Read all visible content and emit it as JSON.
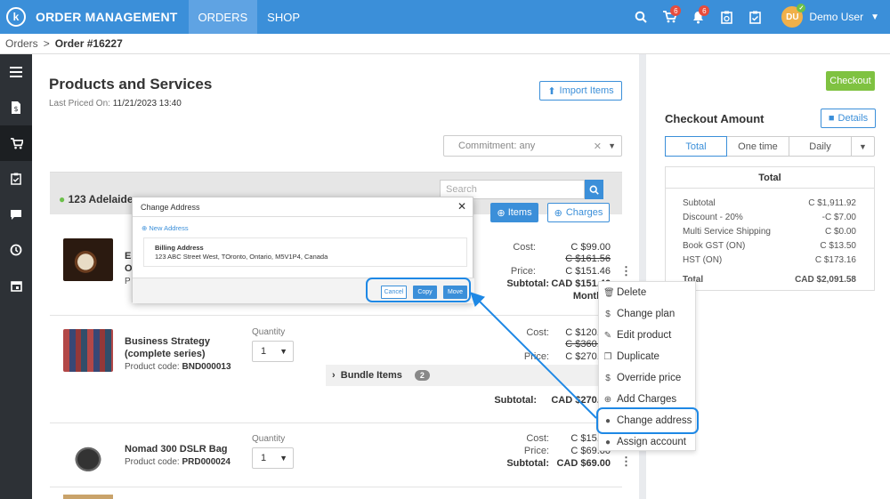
{
  "header": {
    "logo": "k",
    "app_title": "ORDER MANAGEMENT",
    "nav": [
      "ORDERS",
      "SHOP"
    ],
    "cart_badge": "6",
    "bell_badge": "6",
    "avatar_initials": "DU",
    "user_name": "Demo User"
  },
  "breadcrumb": {
    "parent": "Orders",
    "sep": ">",
    "current": "Order #16227"
  },
  "page": {
    "title": "Products and Services",
    "last_priced_label": "Last Priced On:",
    "last_priced_value": "11/21/2023 13:40",
    "import_label": "Import Items",
    "commitment_placeholder": "Commitment: any",
    "address": "123 Adelaide",
    "search_placeholder": "Search",
    "items_label": "Items",
    "charges_label": "Charges"
  },
  "products": [
    {
      "name_part": "Es",
      "name_part2": "O",
      "code_part": "P",
      "cost_label": "Cost:",
      "cost": "C $99.00",
      "list_price": "C $161.56",
      "price_label": "Price:",
      "price": "C $151.46",
      "subtotal_label": "Subtotal:",
      "subtotal": "CAD $151.46",
      "period": "Monthly"
    },
    {
      "name": "Business Strategy (complete series)",
      "code_label": "Product code:",
      "code": "BND000013",
      "qty_label": "Quantity",
      "qty": "1",
      "cost_label": "Cost:",
      "cost": "C $120.00",
      "list_price": "C $360.00",
      "price_label": "Price:",
      "price": "C $270.00",
      "bundle_label": "Bundle Items",
      "bundle_count": "2",
      "subtotal_label": "Subtotal:",
      "subtotal": "CAD $270.00"
    },
    {
      "name": "Nomad 300 DSLR Bag",
      "code_label": "Product code:",
      "code": "PRD000024",
      "qty_label": "Quantity",
      "qty": "1",
      "cost_label": "Cost:",
      "cost": "C $15.00",
      "price_label": "Price:",
      "price": "C $69.00",
      "subtotal_label": "Subtotal:",
      "subtotal": "CAD $69.00"
    }
  ],
  "context_menu": [
    "Delete",
    "Change plan",
    "Edit product",
    "Duplicate",
    "Override price",
    "Add Charges",
    "Change address",
    "Assign account"
  ],
  "dialog": {
    "title": "Change Address",
    "new_address": "New Address",
    "billing_title": "Billing Address",
    "billing_address": "123 ABC Street West, TOronto, Ontario, M5V1P4, Canada",
    "cancel": "Cancel",
    "copy": "Copy",
    "move": "Move"
  },
  "checkout": {
    "button": "Checkout",
    "title": "Checkout Amount",
    "details": "Details",
    "tabs": [
      "Total",
      "One time",
      "Daily"
    ],
    "box_title": "Total",
    "lines": [
      {
        "label": "Subtotal",
        "value": "C $1,911.92"
      },
      {
        "label": "Discount - 20%",
        "value": "-C $7.00"
      },
      {
        "label": "Multi Service Shipping",
        "value": "C $0.00"
      },
      {
        "label": "Book GST (ON)",
        "value": "C $13.50"
      },
      {
        "label": "HST (ON)",
        "value": "C $173.16"
      }
    ],
    "total_label": "Total",
    "total_value": "CAD $2,091.58"
  },
  "colors": {
    "primary": "#3b8fd9",
    "orange": "#f07c28",
    "green": "#7fc241",
    "highlight": "#1e88e5"
  }
}
